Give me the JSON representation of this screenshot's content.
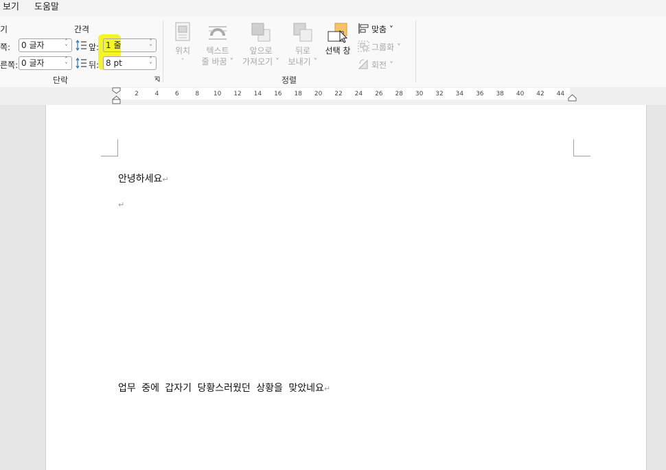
{
  "menu": {
    "items": [
      "보기",
      "도움말"
    ]
  },
  "paragraph_group": {
    "indent_title": "기",
    "spacing_title": "간격",
    "left_label": "쪽:",
    "left_value": "0 글자",
    "right_label": "른쪽:",
    "right_value": "0 글자",
    "before_label": "앞:",
    "before_value": "1 줄",
    "after_label": "뒤:",
    "after_value": "8 pt",
    "group_name": "단락",
    "highlight_color": "#f5f500"
  },
  "arrange_group": {
    "group_name": "정렬",
    "position": {
      "line1": "위치",
      "line2": "˅"
    },
    "wrap_text": {
      "line1": "텍스트",
      "line2": "줄 바꿈 ˅"
    },
    "bring_forward": {
      "line1": "앞으로",
      "line2": "가져오기 ˅"
    },
    "send_backward": {
      "line1": "뒤로",
      "line2": "보내기 ˅"
    },
    "selection_pane": {
      "line1": "선택 창"
    },
    "align": "맞춤 ˅",
    "group": "그룹화 ˅",
    "rotate": "회전 ˅"
  },
  "ruler": {
    "ticks": [
      "2",
      "4",
      "6",
      "8",
      "10",
      "12",
      "14",
      "16",
      "18",
      "20",
      "22",
      "24",
      "26",
      "28",
      "30",
      "32",
      "34",
      "36",
      "38",
      "40",
      "42",
      "44"
    ]
  },
  "document": {
    "para1": "안녕하세요",
    "para2": "",
    "para3": "업무 중에 갑자기 당황스러웠던 상황을 맞았네요",
    "paragraph_mark": "↵"
  },
  "colors": {
    "accent_orange": "#f7c36a",
    "disabled_gray": "#a8a8a8"
  }
}
